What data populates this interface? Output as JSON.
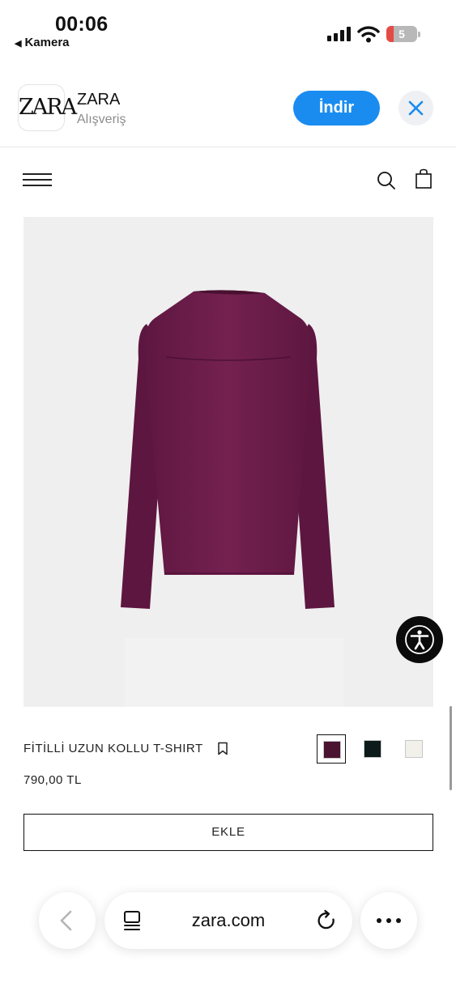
{
  "status_bar": {
    "time": "00:06",
    "back_app_label": "Kamera",
    "battery_level": "5",
    "icons": [
      "signal-icon",
      "wifi-icon",
      "battery-icon"
    ]
  },
  "app_banner": {
    "icon_text": "ZARA",
    "app_name": "ZARA",
    "category": "Alışveriş",
    "open_label": "İndir",
    "accent_color": "#1a8cf0"
  },
  "site_header": {
    "icons": [
      "menu-icon",
      "search-icon",
      "shopping-bag-icon"
    ]
  },
  "product": {
    "name": "FİTİLLİ UZUN KOLLU T-SHIRT",
    "price": "790,00 TL",
    "add_label": "EKLE",
    "colors": [
      {
        "hex": "#4a1330",
        "selected": true
      },
      {
        "hex": "#0d1a1a",
        "selected": false
      },
      {
        "hex": "#f1f0ea",
        "selected": false
      }
    ],
    "garment_color": "#6e1d49"
  },
  "browser_bar": {
    "url": "zara.com",
    "icons": [
      "back-arrow-icon",
      "tabs-icon",
      "reload-icon",
      "more-icon"
    ]
  }
}
